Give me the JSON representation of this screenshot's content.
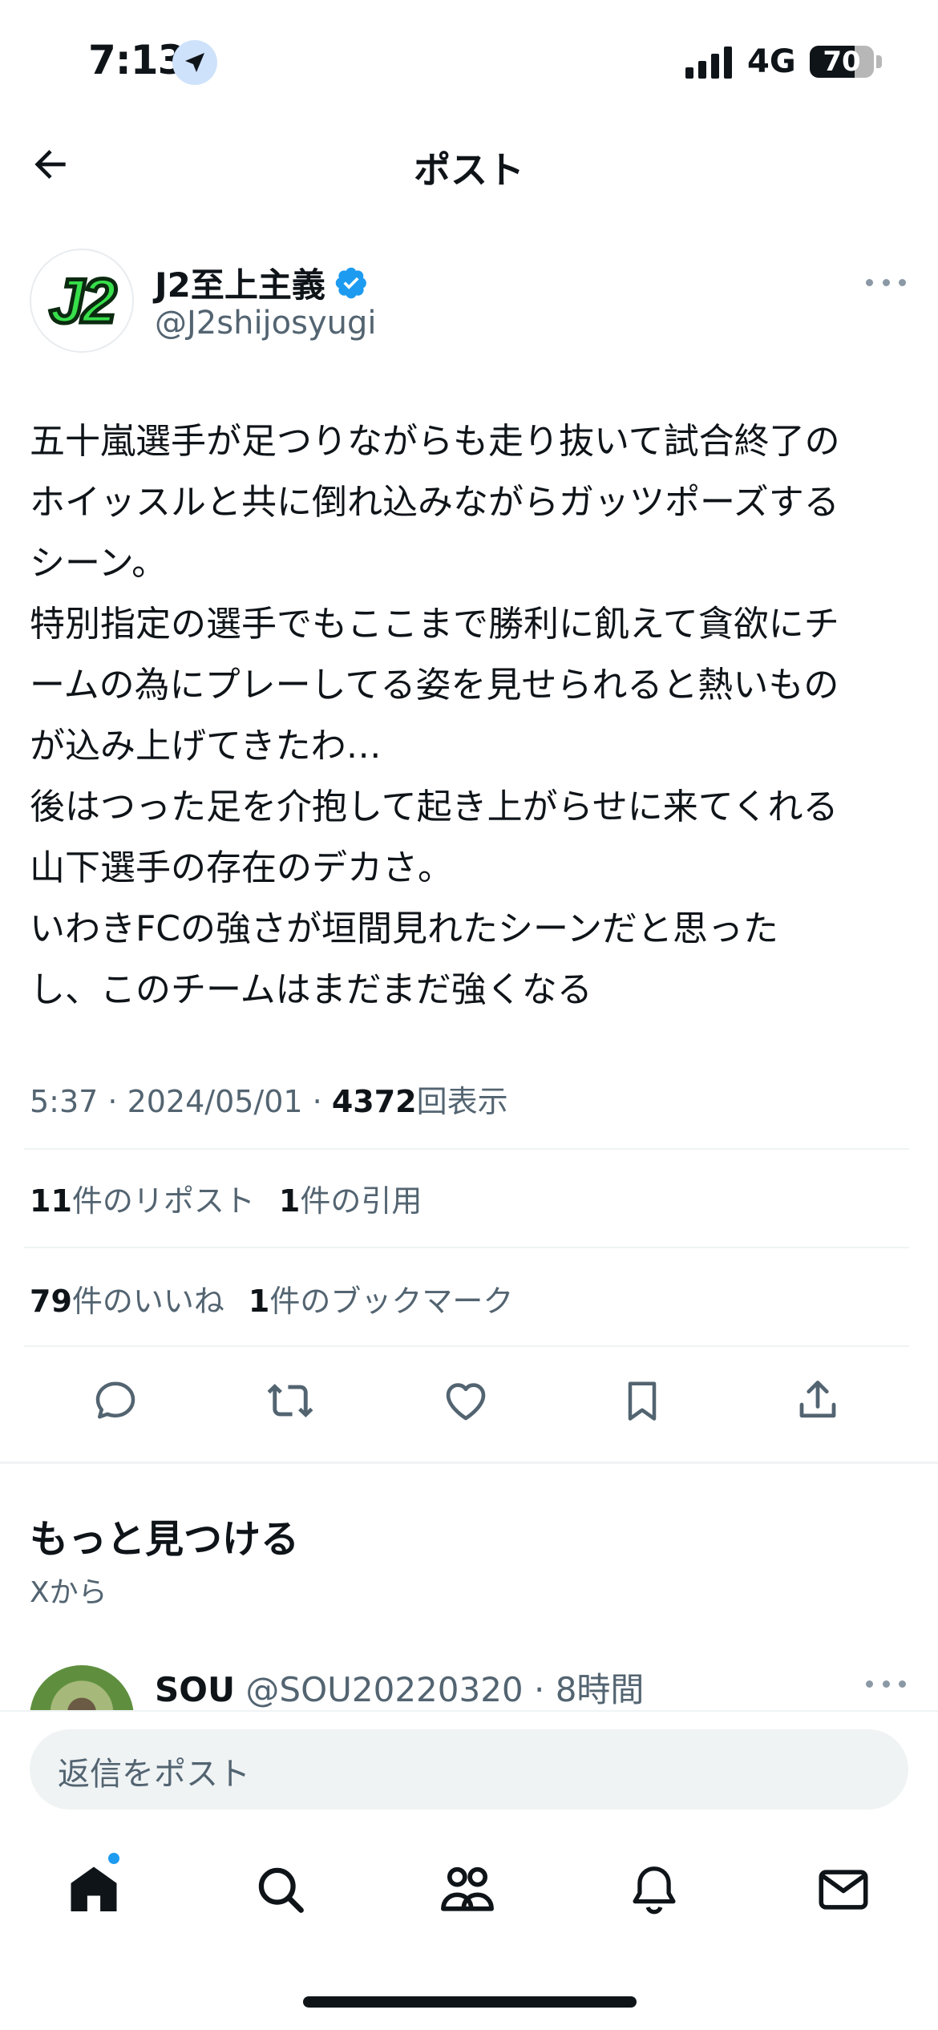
{
  "status_bar": {
    "time": "7:13",
    "network": "4G",
    "battery": "70",
    "battery_level": 0.7
  },
  "header": {
    "title": "ポスト"
  },
  "post": {
    "author_name": "J2至上主義",
    "author_handle": "@J2shijosyugi",
    "avatar_text": "J2",
    "lines": [
      "五十嵐選手が足つりながらも走り抜いて試合終了の",
      "ホイッスルと共に倒れ込みながらガッツポーズする",
      "シーン。",
      "特別指定の選手でもここまで勝利に飢えて貪欲にチ",
      "ームの為にプレーしてる姿を見せられると熱いもの",
      "が込み上げてきたわ…",
      "後はつった足を介抱して起き上がらせに来てくれる",
      "山下選手の存在のデカさ。",
      "いわきFCの強さが垣間見れたシーンだと思った",
      "し、このチームはまだまだ強くなる"
    ],
    "time_date": "5:37 · 2024/05/01 · ",
    "views_count": "4372",
    "views_label": "回表示"
  },
  "stats": {
    "reposts_count": "11",
    "reposts_label": "件のリポスト",
    "quotes_count": "1",
    "quotes_label": "件の引用",
    "likes_count": "79",
    "likes_label": "件のいいね",
    "bookmarks_count": "1",
    "bookmarks_label": "件のブックマーク"
  },
  "actions": {
    "icons": [
      "reply-icon",
      "repost-icon",
      "like-icon",
      "bookmark-icon",
      "share-icon"
    ]
  },
  "discover": {
    "title": "もっと見つける",
    "subtitle": "Xから",
    "suggested": {
      "name": "SOU",
      "handle_time": "@SOU20220320 · 8時間"
    }
  },
  "reply": {
    "placeholder": "返信をポスト"
  },
  "tabbar": {
    "icons": [
      "home-icon",
      "search-icon",
      "communities-icon",
      "notifications-icon",
      "messages-icon"
    ]
  },
  "colors": {
    "accent": "#1d9bf0",
    "text": "#0f1419",
    "secondary": "#536471",
    "divider": "#eff3f4",
    "avatar_green": "#37e04a"
  }
}
